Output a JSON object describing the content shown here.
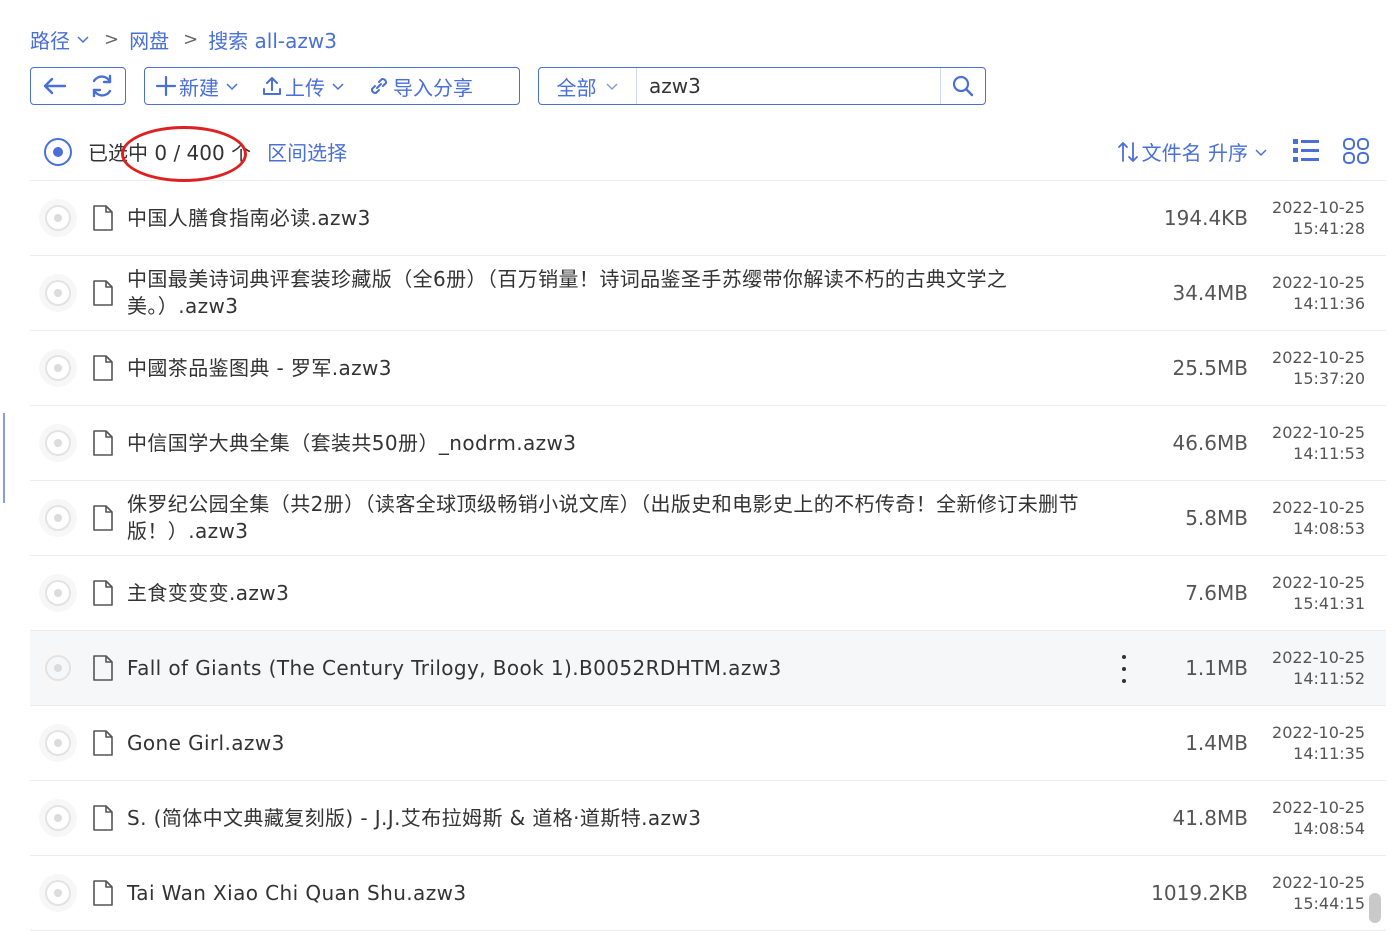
{
  "breadcrumb": {
    "path_label": "路径",
    "sep": ">",
    "crumbs": [
      "网盘",
      "搜索 all-azw3"
    ]
  },
  "toolbar": {
    "new_label": "新建",
    "upload_label": "上传",
    "import_label": "导入分享"
  },
  "search": {
    "scope": "全部",
    "value": "azw3"
  },
  "selection": {
    "prefix": "已选中",
    "count": "0 / 400 个",
    "range_label": "区间选择"
  },
  "sort": {
    "label": "文件名 升序"
  },
  "files": [
    {
      "name": "中国人膳食指南必读.azw3",
      "size": "194.4KB",
      "date": "2022-10-25",
      "time": "15:41:28"
    },
    {
      "name": "中国最美诗词典评套装珍藏版（全6册）（百万销量！诗词品鉴圣手苏缨带你解读不朽的古典文学之美。）.azw3",
      "size": "34.4MB",
      "date": "2022-10-25",
      "time": "14:11:36"
    },
    {
      "name": "中國茶品鉴图典 - 罗军.azw3",
      "size": "25.5MB",
      "date": "2022-10-25",
      "time": "15:37:20"
    },
    {
      "name": "中信国学大典全集（套装共50册）_nodrm.azw3",
      "size": "46.6MB",
      "date": "2022-10-25",
      "time": "14:11:53"
    },
    {
      "name": "侏罗纪公园全集（共2册）（读客全球顶级畅销小说文库）（出版史和电影史上的不朽传奇！全新修订未删节版！）.azw3",
      "size": "5.8MB",
      "date": "2022-10-25",
      "time": "14:08:53"
    },
    {
      "name": "主食变变变.azw3",
      "size": "7.6MB",
      "date": "2022-10-25",
      "time": "15:41:31"
    },
    {
      "name": "Fall of Giants (The Century Trilogy, Book 1).B0052RDHTM.azw3",
      "size": "1.1MB",
      "date": "2022-10-25",
      "time": "14:11:52"
    },
    {
      "name": "Gone Girl.azw3",
      "size": "1.4MB",
      "date": "2022-10-25",
      "time": "14:11:35"
    },
    {
      "name": "S. (简体中文典藏复刻版) - J.J.艾布拉姆斯 & 道格·道斯特.azw3",
      "size": "41.8MB",
      "date": "2022-10-25",
      "time": "14:08:54"
    },
    {
      "name": "Tai Wan Xiao Chi Quan Shu.azw3",
      "size": "1019.2KB",
      "date": "2022-10-25",
      "time": "15:44:15"
    }
  ],
  "colors": {
    "accent": "#4a6fd6",
    "annotation": "#e02020"
  }
}
